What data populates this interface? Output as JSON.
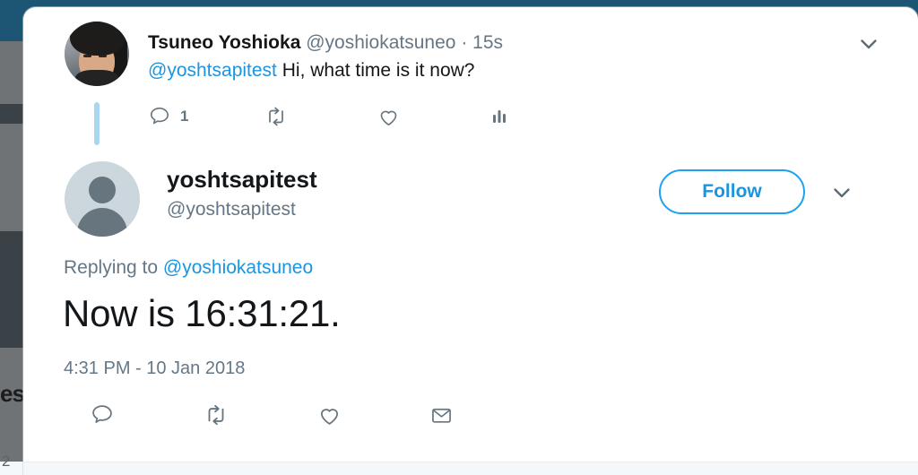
{
  "window": {
    "chrome_color": "#1d5574",
    "background_strip_colors": [
      "#1d5574",
      "#6f7376",
      "#3a4147"
    ],
    "ghost_text": "es",
    "page_number": "2"
  },
  "theme": {
    "twitter_blue": "#1da1f2",
    "link_blue": "#1b95e0",
    "text_dark": "#14171a",
    "text_muted": "#657786",
    "icon_gray": "#66757f",
    "thread_line": "#a9d7f2",
    "avatar_placeholder_bg": "#ccd6dd",
    "divider": "#e6ecf0",
    "card_bg": "#ffffff"
  },
  "parent_tweet": {
    "avatar": "profile-photo-avatar",
    "display_name": "Tsuneo Yoshioka",
    "handle": "@yoshiokatsuneo",
    "separator": "·",
    "timestamp": "15s",
    "body_mention": "@yoshtsapitest",
    "body_text": "Hi, what time is it now?",
    "chevron_icon": "chevron-down-icon",
    "actions": {
      "reply": {
        "icon": "reply-icon",
        "count": "1"
      },
      "retweet": {
        "icon": "retweet-icon",
        "count": ""
      },
      "like": {
        "icon": "heart-icon",
        "count": ""
      },
      "analytics": {
        "icon": "analytics-bars-icon",
        "count": ""
      }
    }
  },
  "main_tweet": {
    "avatar": "default-person-avatar",
    "display_name": "yoshtsapitest",
    "handle": "@yoshtsapitest",
    "follow_label": "Follow",
    "chevron_icon": "chevron-down-icon",
    "replying_to_label": "Replying to",
    "replying_to_handle": "@yoshiokatsuneo",
    "text": "Now is 16:31:21.",
    "timestamp": "4:31 PM - 10 Jan 2018",
    "actions": {
      "reply": {
        "icon": "reply-icon"
      },
      "retweet": {
        "icon": "retweet-icon"
      },
      "like": {
        "icon": "heart-icon"
      },
      "message": {
        "icon": "envelope-icon"
      }
    }
  }
}
